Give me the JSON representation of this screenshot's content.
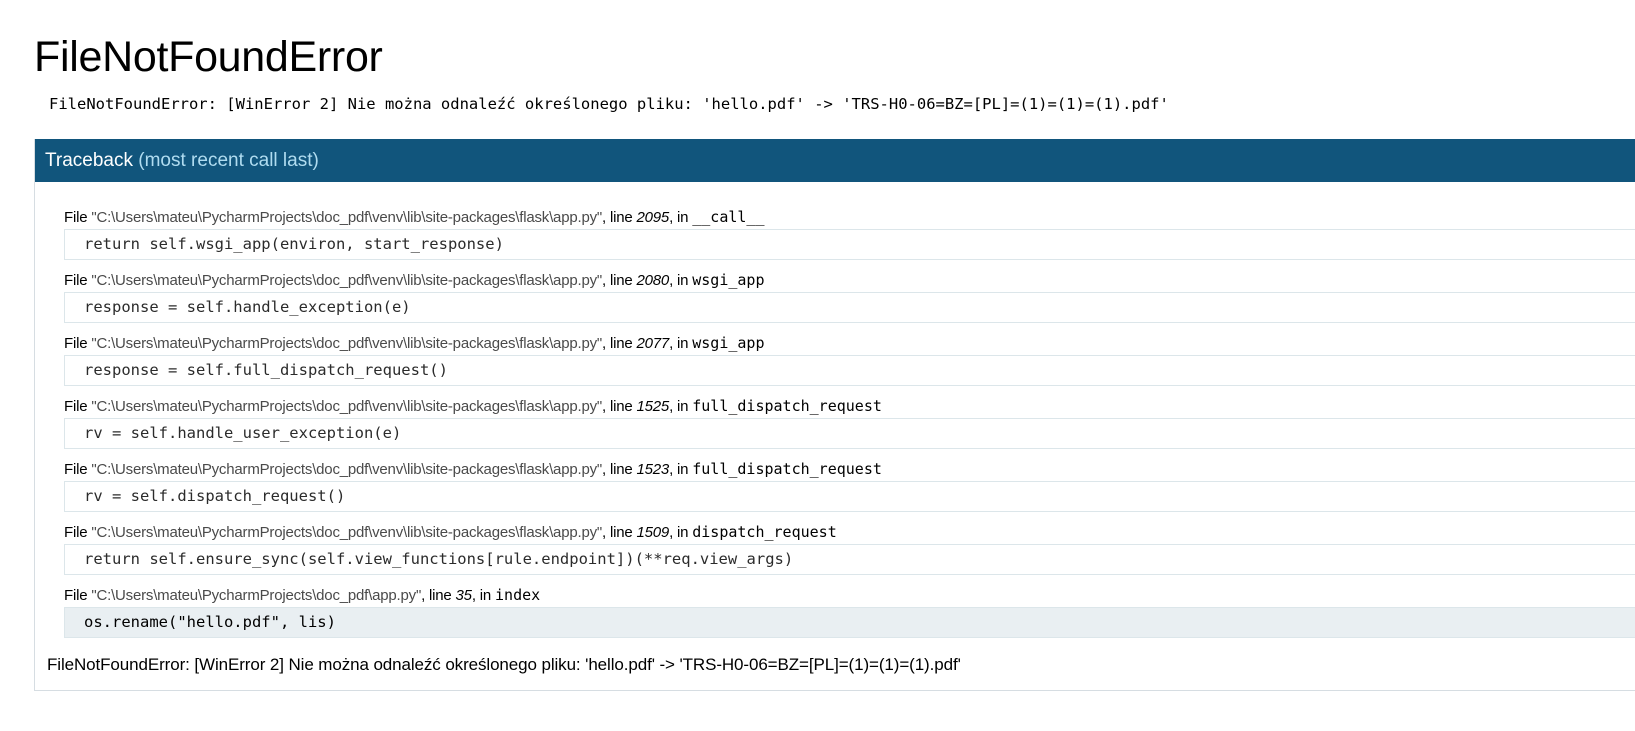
{
  "title": "FileNotFoundError",
  "error_message": "FileNotFoundError: [WinError 2] Nie można odnaleźć określonego pliku: 'hello.pdf' -> 'TRS-H0-06=BZ=[PL]=(1)=(1)=(1).pdf'",
  "traceback": {
    "label": "Traceback",
    "sublabel": "(most recent call last)",
    "frames": [
      {
        "file_prefix": "File ",
        "path": "\"C:\\Users\\mateu\\PycharmProjects\\doc_pdf\\venv\\lib\\site-packages\\flask\\app.py\"",
        "line_prefix": ", line ",
        "line": "2095",
        "in_prefix": ", in ",
        "function": "__call__",
        "code": "return self.wsgi_app(environ, start_response)"
      },
      {
        "file_prefix": "File ",
        "path": "\"C:\\Users\\mateu\\PycharmProjects\\doc_pdf\\venv\\lib\\site-packages\\flask\\app.py\"",
        "line_prefix": ", line ",
        "line": "2080",
        "in_prefix": ", in ",
        "function": "wsgi_app",
        "code": "response = self.handle_exception(e)"
      },
      {
        "file_prefix": "File ",
        "path": "\"C:\\Users\\mateu\\PycharmProjects\\doc_pdf\\venv\\lib\\site-packages\\flask\\app.py\"",
        "line_prefix": ", line ",
        "line": "2077",
        "in_prefix": ", in ",
        "function": "wsgi_app",
        "code": "response = self.full_dispatch_request()"
      },
      {
        "file_prefix": "File ",
        "path": "\"C:\\Users\\mateu\\PycharmProjects\\doc_pdf\\venv\\lib\\site-packages\\flask\\app.py\"",
        "line_prefix": ", line ",
        "line": "1525",
        "in_prefix": ", in ",
        "function": "full_dispatch_request",
        "code": "rv = self.handle_user_exception(e)"
      },
      {
        "file_prefix": "File ",
        "path": "\"C:\\Users\\mateu\\PycharmProjects\\doc_pdf\\venv\\lib\\site-packages\\flask\\app.py\"",
        "line_prefix": ", line ",
        "line": "1523",
        "in_prefix": ", in ",
        "function": "full_dispatch_request",
        "code": "rv = self.dispatch_request()"
      },
      {
        "file_prefix": "File ",
        "path": "\"C:\\Users\\mateu\\PycharmProjects\\doc_pdf\\venv\\lib\\site-packages\\flask\\app.py\"",
        "line_prefix": ", line ",
        "line": "1509",
        "in_prefix": ", in ",
        "function": "dispatch_request",
        "code": "return self.ensure_sync(self.view_functions[rule.endpoint])(**req.view_args)"
      },
      {
        "file_prefix": "File ",
        "path": "\"C:\\Users\\mateu\\PycharmProjects\\doc_pdf\\app.py\"",
        "line_prefix": ", line ",
        "line": "35",
        "in_prefix": ", in ",
        "function": "index",
        "code": "os.rename(\"hello.pdf\", lis)"
      }
    ],
    "final_message": "FileNotFoundError: [WinError 2] Nie można odnaleźć określonego pliku: 'hello.pdf' -> 'TRS-H0-06=BZ=[PL]=(1)=(1)=(1).pdf'"
  },
  "colors": {
    "header_background": "#11557c",
    "header_sublabel": "#b0dcf0",
    "current_frame_background": "#e9eff2"
  }
}
